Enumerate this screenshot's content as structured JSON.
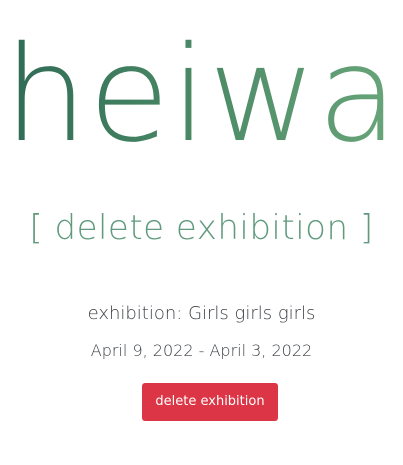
{
  "header": {
    "logo_text": "heiwa"
  },
  "page": {
    "title_open": "[",
    "title_text": "delete exhibition",
    "title_close": "]"
  },
  "exhibition": {
    "name_line": "exhibition: Girls girls girls",
    "dates_line": "April 9, 2022 - April 3, 2022"
  },
  "actions": {
    "delete_label": "delete exhibition",
    "delete_color": "#dc3545"
  },
  "theme": {
    "logo_gradient_start": "#2f6a55",
    "logo_gradient_end": "#6aa67a",
    "subtitle_color": "#5f9a7d"
  }
}
